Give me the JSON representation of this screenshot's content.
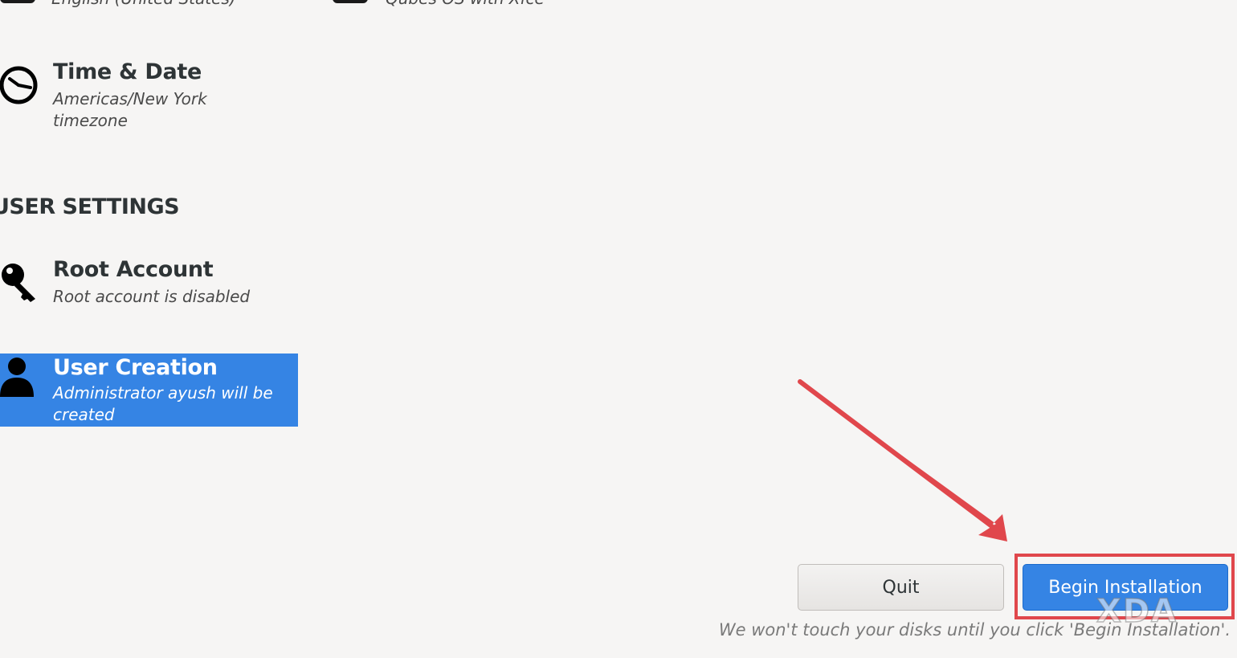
{
  "top_row": {
    "left_status": "English (United States)",
    "right_status": "Qubes OS with Xfce"
  },
  "localization": {
    "time_date": {
      "title": "Time & Date",
      "status": "Americas/New York timezone",
      "icon": "clock-icon"
    }
  },
  "user_settings": {
    "heading": "USER SETTINGS",
    "root_account": {
      "title": "Root Account",
      "status": "Root account is disabled",
      "icon": "key-icon"
    },
    "user_creation": {
      "title": "User Creation",
      "status": "Administrator ayush will be created",
      "icon": "user-icon",
      "selected": true
    }
  },
  "actions": {
    "quit_label": "Quit",
    "begin_label": "Begin Installation",
    "footer_note": "We won't touch your disks until you click 'Begin Installation'."
  },
  "annotation": {
    "color": "#e0474c",
    "watermark": "XDA"
  },
  "colors": {
    "accent": "#3584e4",
    "background": "#f6f5f4"
  }
}
